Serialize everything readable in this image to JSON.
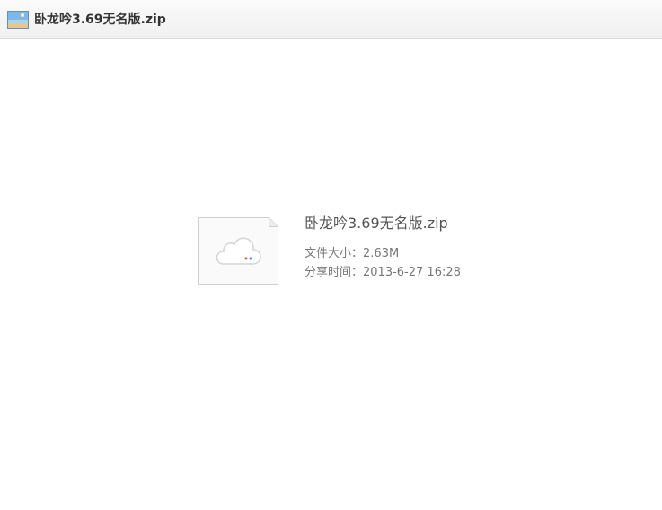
{
  "header": {
    "title": "卧龙吟3.69无名版.zip",
    "icon": "image-file-icon"
  },
  "file": {
    "name": "卧龙吟3.69无名版.zip",
    "icon": "cloud-file-icon",
    "size_label": "文件大小：",
    "size_value": "2.63M",
    "share_time_label": "分享时间：",
    "share_time_value": "2013-6-27 16:28"
  },
  "colors": {
    "header_bg": "#f4f4f4",
    "title_text": "#333333",
    "meta_text": "#777777",
    "dot_red": "#e8555a",
    "dot_blue": "#4a90d9"
  }
}
